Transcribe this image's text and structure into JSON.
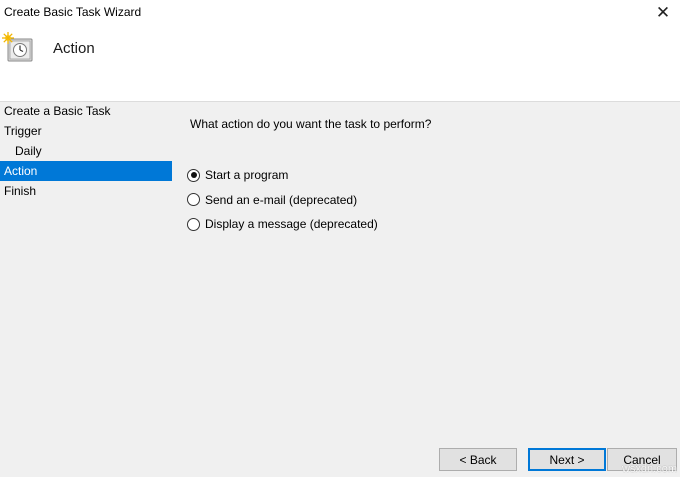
{
  "window": {
    "title": "Create Basic Task Wizard",
    "close_label": "✕"
  },
  "header": {
    "heading": "Action"
  },
  "sidebar": {
    "items": [
      {
        "label": "Create a Basic Task"
      },
      {
        "label": "Trigger"
      },
      {
        "label": "Daily"
      },
      {
        "label": "Action"
      },
      {
        "label": "Finish"
      }
    ],
    "active": "Action"
  },
  "main": {
    "prompt": "What action do you want the task to perform?",
    "options": [
      {
        "label": "Start a program",
        "selected": true
      },
      {
        "label": "Send an e-mail (deprecated)",
        "selected": false
      },
      {
        "label": "Display a message (deprecated)",
        "selected": false
      }
    ]
  },
  "footer": {
    "back_label": "< Back",
    "next_label": "Next >",
    "cancel_label": "Cancel"
  },
  "watermark": "wsxdn.com",
  "colors": {
    "accent": "#0078d7",
    "panel_bg": "#f0f0f0",
    "header_bg": "#ffffff"
  }
}
